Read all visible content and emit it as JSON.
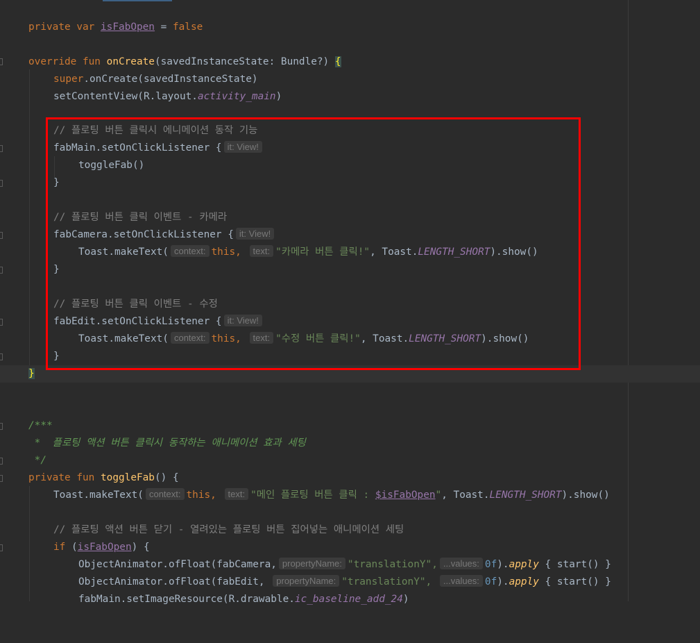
{
  "editor": {
    "language": "kotlin",
    "property": {
      "modifier": "private",
      "keyword": "var",
      "name": "isFabOpen",
      "assign": " = ",
      "value": "false"
    },
    "onCreate": {
      "override": "override",
      "fun": "fun",
      "name": "onCreate",
      "params": "(savedInstanceState: Bundle?) ",
      "open_brace": "{",
      "close_brace": "}",
      "super_kw": "super",
      "super_call": ".onCreate(savedInstanceState)",
      "set_content": "setContentView(R.layout.",
      "layout_name": "activity_main",
      "close_paren": ")"
    },
    "listeners": {
      "comment_main": "// 플로팅 버튼 클릭시 에니메이션 동작 기능",
      "fab_main": "fabMain.setOnClickListener {",
      "hint_it": "it: View!",
      "toggle_call": "toggleFab()",
      "close": "}",
      "comment_camera": "// 플로팅 버튼 클릭 이벤트 - 카메라",
      "fab_camera": "fabCamera.setOnClickListener {",
      "toast_make": "Toast.makeText(",
      "hint_context": "context:",
      "this_kw": "this,",
      "hint_text": "text:",
      "camera_msg": "\"카메라 버튼 클릭!\"",
      "toast_cls": ", Toast.",
      "length_short": "LENGTH_SHORT",
      "show": ").show()",
      "comment_edit": "// 플로팅 버튼 클릭 이벤트 - 수정",
      "fab_edit": "fabEdit.setOnClickListener {",
      "edit_msg": "\"수정 버튼 클릭!\""
    },
    "doc": {
      "open": "/***",
      "body": " *  플로팅 액션 버튼 클릭시 동작하는 애니메이션 효과 세팅",
      "close": " */"
    },
    "toggleFab": {
      "modifier": "private",
      "fun": "fun",
      "name": "toggleFab",
      "params": "() {",
      "main_msg_prefix": "\"메인 플로팅 버튼 클릭 : ",
      "main_msg_var": "$isFabOpen",
      "main_msg_suffix": "\"",
      "comment_close": "// 플로팅 액션 버튼 닫기 - 열려있는 플로팅 버튼 집어넣는 애니메이션 세팅",
      "if_kw": "if",
      "if_open": " (",
      "if_var": "isFabOpen",
      "if_close": ") {",
      "anim_camera": "ObjectAnimator.ofFloat(fabCamera,",
      "anim_edit": "ObjectAnimator.ofFloat(fabEdit,",
      "hint_property": "propertyName:",
      "translation": "\"translationY\",",
      "hint_values": "...values:",
      "zero_f": "0f",
      "apply_close": ").",
      "apply": "apply",
      "start_block": " { start() }",
      "set_image": "fabMain.setImageResource(R.drawable.",
      "drawable_name": "ic_baseline_add_24",
      "set_image_close": ")"
    }
  }
}
